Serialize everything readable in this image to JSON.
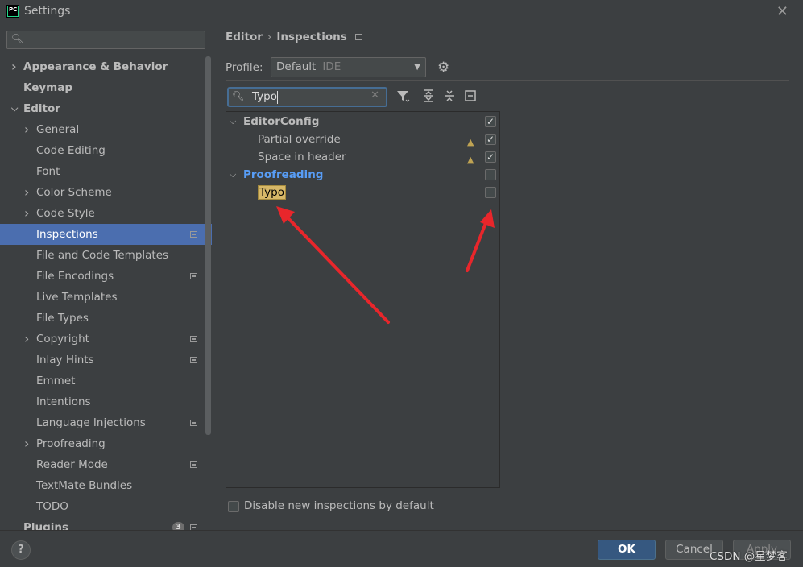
{
  "window": {
    "title": "Settings",
    "logo_text": "PC"
  },
  "sidebar": {
    "search_placeholder": "",
    "items": [
      {
        "label": "Appearance & Behavior",
        "level": 0,
        "bold": true,
        "chevron": "right"
      },
      {
        "label": "Keymap",
        "level": 0,
        "bold": true,
        "chevron": ""
      },
      {
        "label": "Editor",
        "level": 0,
        "bold": true,
        "chevron": "down"
      },
      {
        "label": "General",
        "level": 1,
        "chevron": "right"
      },
      {
        "label": "Code Editing",
        "level": 1
      },
      {
        "label": "Font",
        "level": 1
      },
      {
        "label": "Color Scheme",
        "level": 1,
        "chevron": "right"
      },
      {
        "label": "Code Style",
        "level": 1,
        "chevron": "right"
      },
      {
        "label": "Inspections",
        "level": 1,
        "selected": true,
        "project_icon": true
      },
      {
        "label": "File and Code Templates",
        "level": 1
      },
      {
        "label": "File Encodings",
        "level": 1,
        "project_icon": true
      },
      {
        "label": "Live Templates",
        "level": 1
      },
      {
        "label": "File Types",
        "level": 1
      },
      {
        "label": "Copyright",
        "level": 1,
        "chevron": "right",
        "project_icon": true
      },
      {
        "label": "Inlay Hints",
        "level": 1,
        "project_icon": true
      },
      {
        "label": "Emmet",
        "level": 1
      },
      {
        "label": "Intentions",
        "level": 1
      },
      {
        "label": "Language Injections",
        "level": 1,
        "project_icon": true
      },
      {
        "label": "Proofreading",
        "level": 1,
        "chevron": "right"
      },
      {
        "label": "Reader Mode",
        "level": 1,
        "project_icon": true
      },
      {
        "label": "TextMate Bundles",
        "level": 1
      },
      {
        "label": "TODO",
        "level": 1
      },
      {
        "label": "Plugins",
        "level": 0,
        "bold": true,
        "badge": "3",
        "project_icon": true
      }
    ]
  },
  "breadcrumb": {
    "parent": "Editor",
    "separator": "›",
    "current": "Inspections"
  },
  "profile": {
    "label": "Profile:",
    "value": "Default",
    "scope": "IDE"
  },
  "filter": {
    "value": "Typo"
  },
  "inspections": [
    {
      "label": "EditorConfig",
      "type": "group",
      "expanded": true,
      "checked": true
    },
    {
      "label": "Partial override",
      "type": "item",
      "warning": true,
      "checked": true
    },
    {
      "label": "Space in header",
      "type": "item",
      "warning": true,
      "checked": true
    },
    {
      "label": "Proofreading",
      "type": "group",
      "expanded": true,
      "checked": false,
      "highlight_group": true
    },
    {
      "label": "Typo",
      "type": "item",
      "checked": false,
      "search_match": true
    }
  ],
  "disable_new": {
    "label": "Disable new inspections by default",
    "checked": false
  },
  "footer": {
    "help": "?",
    "ok": "OK",
    "cancel": "Cancel",
    "apply": "Apply"
  },
  "watermark": "CSDN @星梦客",
  "colors": {
    "selection": "#4b6eaf",
    "accent_group": "#589df6",
    "search_highlight": "#d7b868",
    "arrow": "#e8262b"
  }
}
